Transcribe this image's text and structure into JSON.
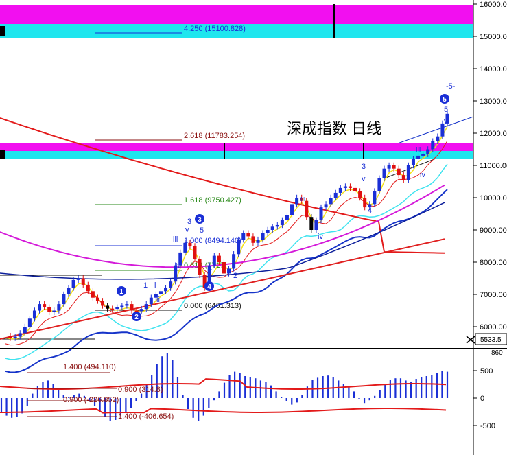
{
  "title": "深成指数 日线",
  "colors": {
    "up": "#1a2fd6",
    "down": "#e01010",
    "ma_red": "#e31a1a",
    "ma_blue": "#1533c9",
    "ma_cyan": "#3fe3ef",
    "ma_magenta": "#d41ad9",
    "band_magenta": "#f20ff0",
    "band_cyan": "#1fe6ee",
    "fib_line": "#8a1010",
    "bg": "#ffffff"
  },
  "price_axis": {
    "ticks": [
      "16000.00",
      "15000.00",
      "14000.00",
      "13000.00",
      "12000.00",
      "11000.00",
      "10000.00",
      "9000.00",
      "8000.00",
      "7000.00",
      "6000.00"
    ],
    "current_price": "5533.5"
  },
  "macd_axis": {
    "ticks": [
      "500",
      "0",
      "-500"
    ],
    "top_value": "860"
  },
  "fib_levels": [
    {
      "label": "4.250 (15100.828)",
      "color": "#1a2fd6"
    },
    {
      "label": "2.618 (11783.254)",
      "color": "#8a1010"
    },
    {
      "label": "1.618 (9750.427)",
      "color": "#2a8a1a"
    },
    {
      "label": "1.000 (8494.140)",
      "color": "#1a2fd6"
    },
    {
      "label": "0.618 (7717)",
      "color": "#2a8a1a"
    },
    {
      "label": "0.000 (6461.313)",
      "color": "#111111"
    }
  ],
  "macd_levels": [
    {
      "label": "1.400 (494.110)",
      "color": "#8a1010"
    },
    {
      "label": "0.900 (314.8)",
      "color": "#8a1010"
    },
    {
      "label": "0.900 (-226.852)",
      "color": "#8a1010"
    },
    {
      "label": "1.400 (-406.654)",
      "color": "#8a1010"
    }
  ],
  "wave_labels": {
    "circled": [
      "1",
      "2",
      "3",
      "4",
      "5"
    ],
    "sub": [
      "1",
      "2",
      "3",
      "4",
      "5",
      "3",
      "5",
      "i",
      "ii",
      "iii",
      "iv",
      "v",
      "iii",
      "iv",
      "3",
      "v",
      "4",
      "5",
      "v",
      "-5-",
      "iii",
      "iv"
    ]
  },
  "chart_data": {
    "type": "candlestick",
    "title": "深成指数 日线",
    "y_range": [
      5300,
      16300
    ],
    "grid": false,
    "price_series": [
      5720,
      5650,
      5690,
      5800,
      6000,
      6250,
      6500,
      6700,
      6600,
      6450,
      6500,
      6700,
      7000,
      7200,
      7450,
      7500,
      7300,
      7100,
      6900,
      6800,
      6650,
      6560,
      6550,
      6600,
      6650,
      6700,
      6500,
      6480,
      6550,
      6700,
      6900,
      7000,
      7100,
      7200,
      7400,
      7900,
      8300,
      8600,
      8500,
      8100,
      7600,
      7200,
      7900,
      8200,
      8000,
      7650,
      7800,
      8250,
      8700,
      8900,
      8800,
      8600,
      8700,
      8900,
      9000,
      9100,
      9150,
      9300,
      9450,
      9800,
      10000,
      9900,
      9400,
      9000,
      9300,
      9700,
      9800,
      10000,
      10150,
      10300,
      10350,
      10300,
      10200,
      10000,
      9700,
      9800,
      10200,
      10600,
      10900,
      11000,
      10900,
      10700,
      10550,
      11000,
      11200,
      11300,
      11350,
      11500,
      11750,
      11900,
      12300,
      12600
    ],
    "macd_range": [
      -860,
      860
    ],
    "macd_hist": [
      -250,
      -320,
      -360,
      -340,
      -280,
      -150,
      80,
      220,
      300,
      320,
      260,
      150,
      60,
      20,
      60,
      80,
      40,
      -60,
      -150,
      -250,
      -350,
      -420,
      -400,
      -320,
      -260,
      -180,
      -60,
      80,
      250,
      420,
      620,
      760,
      820,
      700,
      380,
      60,
      -200,
      -360,
      -420,
      -320,
      -180,
      -40,
      120,
      280,
      420,
      480,
      460,
      400,
      380,
      360,
      320,
      300,
      230,
      120,
      20,
      -60,
      -120,
      -80,
      60,
      210,
      330,
      370,
      400,
      410,
      380,
      320,
      260,
      220,
      120,
      -20,
      -90,
      -40,
      40,
      150,
      260,
      330,
      360,
      360,
      320,
      300,
      350,
      380,
      400,
      420,
      460,
      500,
      480
    ]
  }
}
